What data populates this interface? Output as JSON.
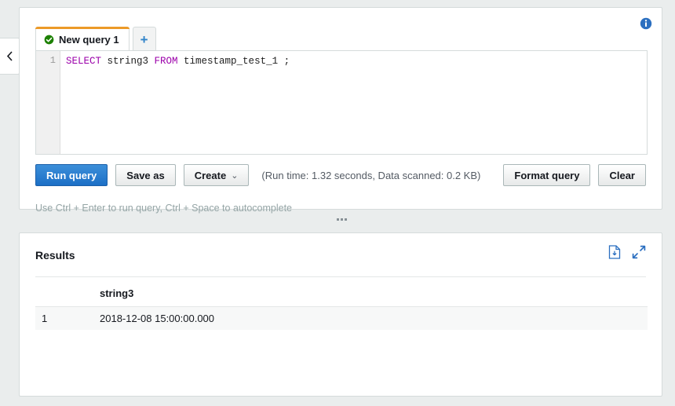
{
  "sidebar": {
    "collapse_icon": "chevron-left-icon"
  },
  "query_panel": {
    "info_icon": "info-icon",
    "tabs": [
      {
        "label": "New query 1",
        "status_icon": "check-circle-icon",
        "active": true
      }
    ],
    "add_tab_label": "+",
    "editor": {
      "line_number": "1",
      "tokens": [
        {
          "text": "SELECT",
          "type": "keyword"
        },
        {
          "text": " string3 ",
          "type": "identifier"
        },
        {
          "text": "FROM",
          "type": "keyword"
        },
        {
          "text": " timestamp_test_1 ;",
          "type": "identifier"
        }
      ],
      "full_text": "SELECT string3 FROM timestamp_test_1 ;"
    },
    "actions": {
      "run_query": "Run query",
      "save_as": "Save as",
      "create": "Create",
      "create_caret": "∨",
      "run_info": "(Run time: 1.32 seconds, Data scanned: 0.2 KB)",
      "format_query": "Format query",
      "clear": "Clear"
    },
    "hint": "Use Ctrl + Enter to run query, Ctrl + Space to autocomplete"
  },
  "splitter": {
    "handle_icon": "drag-handle-icon"
  },
  "results_panel": {
    "title": "Results",
    "download_icon": "download-file-icon",
    "expand_icon": "expand-diagonal-icon",
    "columns": [
      "",
      "string3"
    ],
    "rows": [
      {
        "index": "1",
        "string3": "2018-12-08 15:00:00.000"
      }
    ]
  },
  "colors": {
    "accent_orange": "#ec9a28",
    "primary_blue": "#1c6fc6",
    "link_blue": "#3184c9",
    "success_green": "#1d8102",
    "keyword_purple": "#9b00aa",
    "page_background": "#eaeded",
    "panel_border": "#d5dbdb",
    "row_background": "#f7f8f8"
  }
}
